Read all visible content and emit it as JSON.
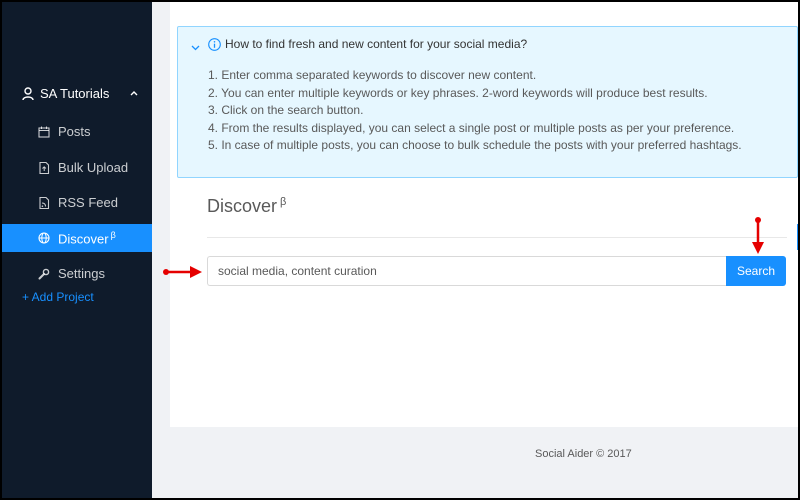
{
  "sidebar": {
    "project": {
      "label": "SA Tutorials",
      "icon": "user-icon"
    },
    "items": [
      {
        "label": "Posts",
        "icon": "calendar-icon"
      },
      {
        "label": "Bulk Upload",
        "icon": "file-upload-icon"
      },
      {
        "label": "RSS Feed",
        "icon": "rss-file-icon"
      },
      {
        "label": "Discover",
        "sup": "β",
        "icon": "globe-icon",
        "active": true
      },
      {
        "label": "Settings",
        "icon": "wrench-icon"
      }
    ],
    "add_project": "+ Add Project"
  },
  "info": {
    "title": "How to find fresh and new content for your social media?",
    "steps": [
      "1. Enter comma separated keywords to discover new content.",
      "2. You can enter multiple keywords or key phrases. 2-word keywords will produce best results.",
      "3. Click on the search button.",
      "4. From the results displayed, you can select a single post or multiple posts as per your preference.",
      "5. In case of multiple posts, you can choose to bulk schedule the posts with your preferred hashtags."
    ]
  },
  "discover": {
    "title": "Discover",
    "sup": "β"
  },
  "search": {
    "value": "social media, content curation",
    "button_label": "Search"
  },
  "footer": {
    "text": "Social Aider © 2017"
  },
  "colors": {
    "accent": "#1890ff",
    "sidebar": "#0f1b2b",
    "info_bg": "#e6f7ff",
    "annotation": "#e50000"
  }
}
